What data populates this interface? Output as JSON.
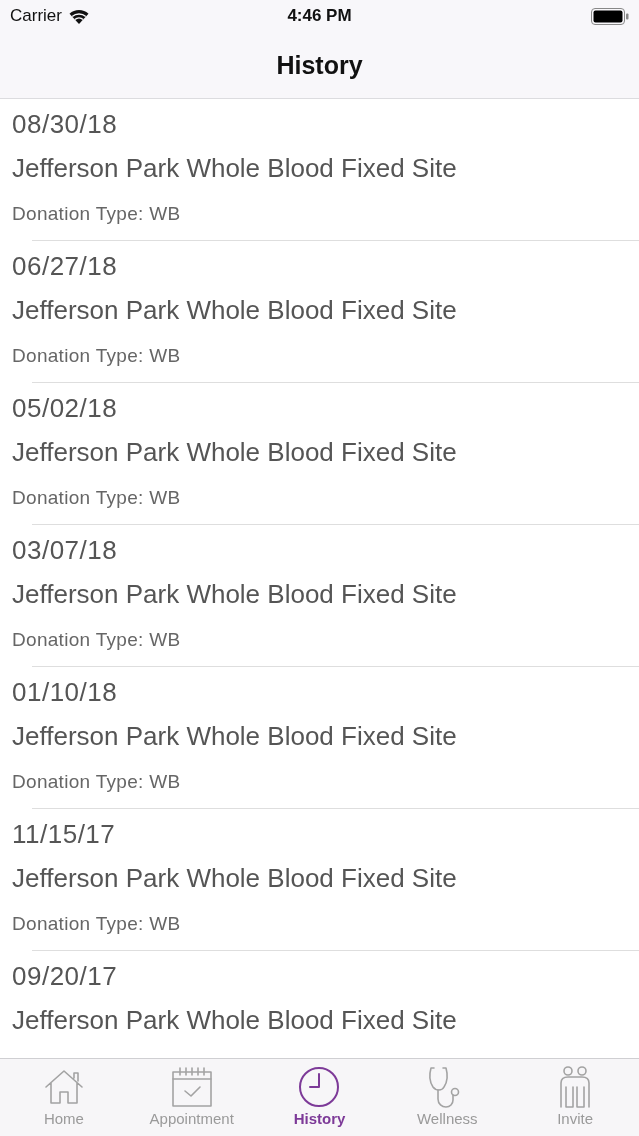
{
  "status_bar": {
    "carrier": "Carrier",
    "time": "4:46 PM"
  },
  "nav_bar": {
    "title": "History"
  },
  "donations": [
    {
      "date": "08/30/18",
      "site": "Jefferson Park Whole Blood Fixed Site",
      "donation_type": "Donation Type: WB"
    },
    {
      "date": "06/27/18",
      "site": "Jefferson Park Whole Blood Fixed Site",
      "donation_type": "Donation Type: WB"
    },
    {
      "date": "05/02/18",
      "site": "Jefferson Park Whole Blood Fixed Site",
      "donation_type": "Donation Type: WB"
    },
    {
      "date": "03/07/18",
      "site": "Jefferson Park Whole Blood Fixed Site",
      "donation_type": "Donation Type: WB"
    },
    {
      "date": "01/10/18",
      "site": "Jefferson Park Whole Blood Fixed Site",
      "donation_type": "Donation Type: WB"
    },
    {
      "date": "11/15/17",
      "site": "Jefferson Park Whole Blood Fixed Site",
      "donation_type": "Donation Type: WB"
    },
    {
      "date": "09/20/17",
      "site": "Jefferson Park Whole Blood Fixed Site"
    }
  ],
  "tab_bar": {
    "tabs": [
      {
        "label": "Home",
        "kind": "home",
        "selected": false
      },
      {
        "label": "Appointment",
        "kind": "calendar",
        "selected": false
      },
      {
        "label": "History",
        "kind": "clock",
        "selected": true
      },
      {
        "label": "Wellness",
        "kind": "stethoscope",
        "selected": false
      },
      {
        "label": "Invite",
        "kind": "people",
        "selected": false
      }
    ]
  }
}
